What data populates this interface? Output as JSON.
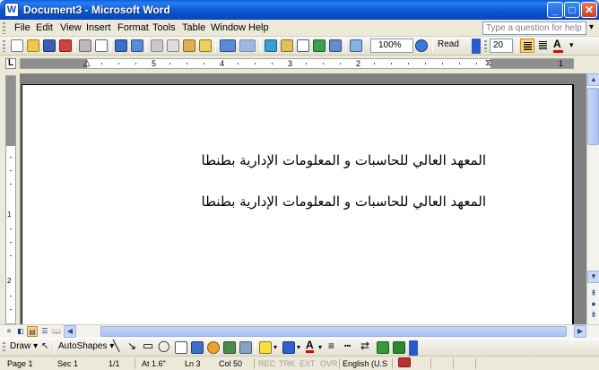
{
  "window": {
    "title": "Document3 - Microsoft Word",
    "min_label": "_",
    "max_label": "□",
    "close_label": "✕",
    "app_icon": "W"
  },
  "menu": {
    "items": [
      "File",
      "Edit",
      "View",
      "Insert",
      "Format",
      "Tools",
      "Table",
      "Window",
      "Help"
    ],
    "help_placeholder": "Type a question for help"
  },
  "toolbar": {
    "icons": [
      "new-document-icon",
      "open-icon",
      "save-icon",
      "permission-icon",
      "print-icon",
      "print-preview-icon",
      "spelling-icon",
      "research-icon",
      "cut-icon",
      "copy-icon",
      "paste-icon",
      "format-painter-icon",
      "undo-icon",
      "redo-icon",
      "hyperlink-icon",
      "tables-borders-icon",
      "insert-table-icon",
      "insert-excel-icon",
      "columns-icon",
      "drawing-icon",
      "document-map-icon",
      "show-hide-icon",
      "help-icon"
    ],
    "zoom": "100%",
    "read_label": "Read",
    "font_size": "20",
    "font_color_label": "A",
    "font_color": "#e00000"
  },
  "ruler": {
    "corner": "L",
    "numbers": [
      "1",
      "2",
      "3",
      "4",
      "5"
    ],
    "vertical_numbers": [
      "1",
      "2"
    ]
  },
  "document": {
    "lines": [
      "المعهد العالي للحاسبات و المعلومات الإدارية بطنطا",
      "المعهد العالي للحاسبات و المعلومات الإدارية بطنطا"
    ]
  },
  "drawbar": {
    "draw_label": "Draw ▾",
    "autoshapes_label": "AutoShapes ▾"
  },
  "status": {
    "page": "Page 1",
    "sec": "Sec 1",
    "pages": "1/1",
    "at": "At 1.6\"",
    "ln": "Ln 3",
    "col": "Col 50",
    "rec": "REC",
    "trk": "TRK",
    "ext": "EXT",
    "ovr": "OVR",
    "language": "English (U.S"
  },
  "colors": {
    "titlebar": "#0a58d0",
    "active_button": "#ffd37c",
    "page_bg": "#ffffff",
    "workspace": "#808080"
  }
}
